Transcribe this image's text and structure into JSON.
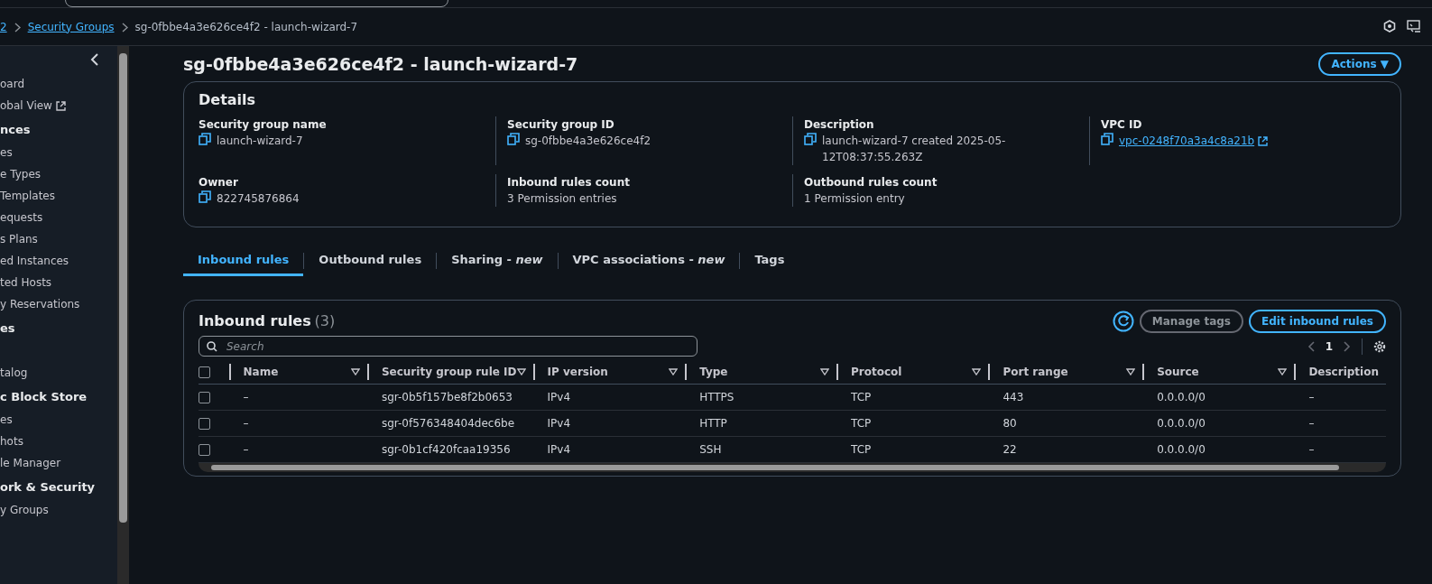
{
  "breadcrumb": [
    {
      "label": "2",
      "kind": "link"
    },
    {
      "label": "Security Groups",
      "kind": "link"
    },
    {
      "label": "sg-0fbbe4a3e626ce4f2 - launch-wizard-7",
      "kind": "current"
    }
  ],
  "sidebar": {
    "items": [
      {
        "label": "oard",
        "kind": "item"
      },
      {
        "label": "obal View",
        "kind": "external"
      },
      {
        "label": "nces",
        "kind": "heading"
      },
      {
        "label": "es",
        "kind": "item"
      },
      {
        "label": "e Types",
        "kind": "item"
      },
      {
        "label": "Templates",
        "kind": "item"
      },
      {
        "label": "equests",
        "kind": "item"
      },
      {
        "label": "s Plans",
        "kind": "item"
      },
      {
        "label": "ed Instances",
        "kind": "item"
      },
      {
        "label": "ted Hosts",
        "kind": "item"
      },
      {
        "label": "y Reservations",
        "kind": "item"
      },
      {
        "label": "es",
        "kind": "heading"
      },
      {
        "kind": "spacer"
      },
      {
        "label": "talog",
        "kind": "item"
      },
      {
        "label": "c Block Store",
        "kind": "heading"
      },
      {
        "label": "es",
        "kind": "item"
      },
      {
        "label": "hots",
        "kind": "item"
      },
      {
        "label": "le Manager",
        "kind": "item"
      },
      {
        "label": "ork & Security",
        "kind": "heading"
      },
      {
        "label": "y Groups",
        "kind": "item"
      }
    ]
  },
  "page_title": "sg-0fbbe4a3e626ce4f2 - launch-wizard-7",
  "actions_button": "Actions ▼",
  "details": {
    "title": "Details",
    "fields": [
      {
        "label": "Security group name",
        "value": "launch-wizard-7",
        "copy": true,
        "link": false
      },
      {
        "label": "Security group ID",
        "value": "sg-0fbbe4a3e626ce4f2",
        "copy": true,
        "link": false
      },
      {
        "label": "Description",
        "value": "launch-wizard-7 created 2025-05-12T08:37:55.263Z",
        "copy": true,
        "link": false
      },
      {
        "label": "VPC ID",
        "value": "vpc-0248f70a3a4c8a21b",
        "copy": true,
        "link": true
      },
      {
        "label": "Owner",
        "value": "822745876864",
        "copy": true,
        "link": false
      },
      {
        "label": "Inbound rules count",
        "value": "3 Permission entries",
        "copy": false,
        "link": false
      },
      {
        "label": "Outbound rules count",
        "value": "1 Permission entry",
        "copy": false,
        "link": false
      }
    ]
  },
  "tabs": [
    {
      "label": "Inbound rules",
      "selected": true
    },
    {
      "label": "Outbound rules",
      "selected": false
    },
    {
      "label": "Sharing - ",
      "badge": "new",
      "selected": false
    },
    {
      "label": "VPC associations - ",
      "badge": "new",
      "selected": false
    },
    {
      "label": "Tags",
      "selected": false
    }
  ],
  "rules": {
    "title": "Inbound rules",
    "count": "(3)",
    "buttons": [
      {
        "label": "Manage tags",
        "disabled": true
      },
      {
        "label": "Edit inbound rules",
        "disabled": false
      }
    ],
    "search": {
      "placeholder": "Search"
    },
    "page": "1",
    "select_all_checked": false,
    "columns": [
      "Name",
      "Security group rule ID",
      "IP version",
      "Type",
      "Protocol",
      "Port range",
      "Source",
      "Description"
    ],
    "rows": [
      {
        "checked": false,
        "cells": [
          "–",
          "sgr-0b5f157be8f2b0653",
          "IPv4",
          "HTTPS",
          "TCP",
          "443",
          "0.0.0.0/0",
          "–"
        ]
      },
      {
        "checked": false,
        "cells": [
          "–",
          "sgr-0f576348404dec6be",
          "IPv4",
          "HTTP",
          "TCP",
          "80",
          "0.0.0.0/0",
          "–"
        ]
      },
      {
        "checked": false,
        "cells": [
          "–",
          "sgr-0b1cf420fcaa19356",
          "IPv4",
          "SSH",
          "TCP",
          "22",
          "0.0.0.0/0",
          "–"
        ]
      }
    ]
  }
}
